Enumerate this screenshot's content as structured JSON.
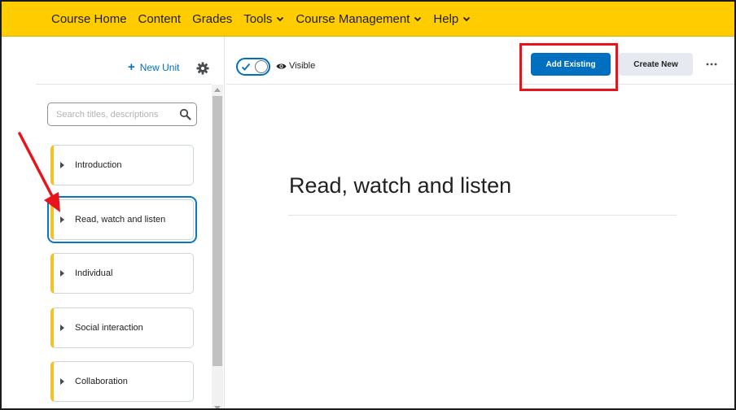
{
  "nav": {
    "items": [
      {
        "label": "Course Home",
        "dropdown": false
      },
      {
        "label": "Content",
        "dropdown": false
      },
      {
        "label": "Grades",
        "dropdown": false
      },
      {
        "label": "Tools",
        "dropdown": true
      },
      {
        "label": "Course Management",
        "dropdown": true
      },
      {
        "label": "Help",
        "dropdown": true
      }
    ]
  },
  "sidebar": {
    "new_unit_label": "New Unit",
    "search_placeholder": "Search titles, descriptions",
    "units": [
      {
        "label": "Introduction",
        "selected": false
      },
      {
        "label": "Read, watch and listen",
        "selected": true
      },
      {
        "label": "Individual",
        "selected": false
      },
      {
        "label": "Social interaction",
        "selected": false
      },
      {
        "label": "Collaboration",
        "selected": false
      }
    ]
  },
  "main": {
    "visibility_label": "Visible",
    "add_existing_label": "Add Existing",
    "create_new_label": "Create New",
    "page_title": "Read, watch and listen"
  },
  "colors": {
    "nav_bg": "#ffcc00",
    "primary_button": "#006fbf",
    "unit_accent": "#f1c22a",
    "annotation_red": "#e8141c",
    "selected_outline": "#0a77c2"
  }
}
